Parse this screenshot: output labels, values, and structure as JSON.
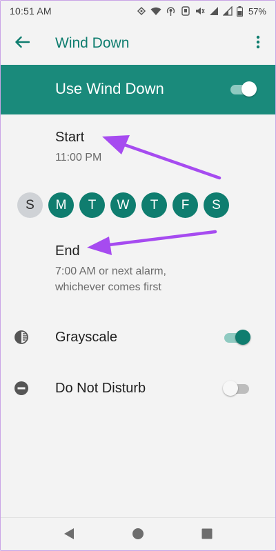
{
  "status_bar": {
    "time": "10:51 AM",
    "battery_percent": "57%"
  },
  "app_bar": {
    "title": "Wind Down"
  },
  "master": {
    "label": "Use Wind Down",
    "enabled": true
  },
  "start": {
    "title": "Start",
    "value": "11:00 PM"
  },
  "days": [
    {
      "label": "S",
      "selected": false
    },
    {
      "label": "M",
      "selected": true
    },
    {
      "label": "T",
      "selected": true
    },
    {
      "label": "W",
      "selected": true
    },
    {
      "label": "T",
      "selected": true
    },
    {
      "label": "F",
      "selected": true
    },
    {
      "label": "S",
      "selected": true
    }
  ],
  "end": {
    "title": "End",
    "value_line1": "7:00 AM or next alarm,",
    "value_line2": "whichever comes first"
  },
  "grayscale": {
    "label": "Grayscale",
    "enabled": true,
    "icon": "contrast-icon"
  },
  "dnd": {
    "label": "Do Not Disturb",
    "enabled": false,
    "icon": "do-not-disturb-icon"
  },
  "colors": {
    "accent": "#0f7d6f",
    "master_bar": "#1a8a7b",
    "annotation_arrow": "#a64bf0"
  }
}
